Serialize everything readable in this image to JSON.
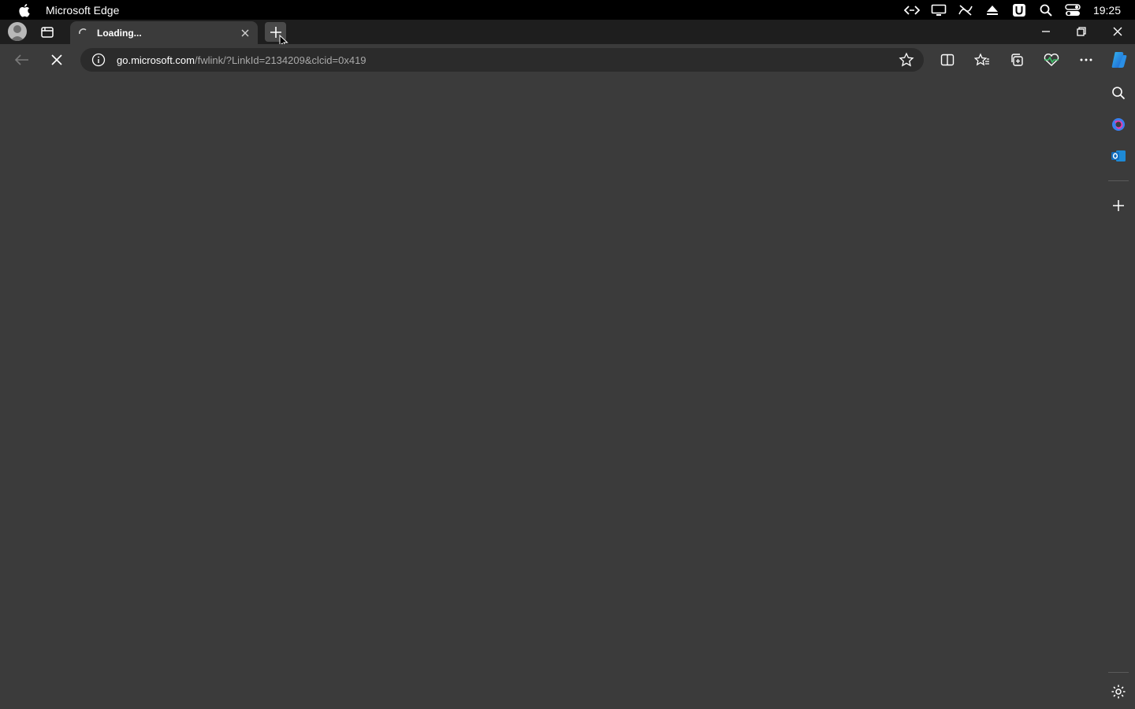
{
  "menubar": {
    "app_name": "Microsoft Edge",
    "clock": "19:25",
    "status_icons": [
      "code-icon",
      "display-icon",
      "crossed-icon",
      "eject-icon",
      "u-badge-icon",
      "search-icon",
      "control-center-icon"
    ]
  },
  "tabs": [
    {
      "title": "Loading...",
      "state": "loading"
    }
  ],
  "address_bar": {
    "host": "go.microsoft.com",
    "path": "/fwlink/?LinkId=2134209&clcid=0x419"
  },
  "toolbar": {
    "icons": [
      "split-screen-icon",
      "favorites-icon",
      "collections-icon",
      "browser-essentials-icon",
      "more-icon",
      "copilot-icon"
    ]
  },
  "sidebar": {
    "icons": [
      "search-icon",
      "bing-icon",
      "outlook-icon",
      "add-icon",
      "settings-icon"
    ]
  },
  "colors": {
    "menubar_bg": "#000000",
    "tabstrip_bg": "#1e1e1e",
    "page_bg": "#3b3b3b",
    "address_bg": "#2b2b2b",
    "accent_blue": "#1e8ad6"
  }
}
